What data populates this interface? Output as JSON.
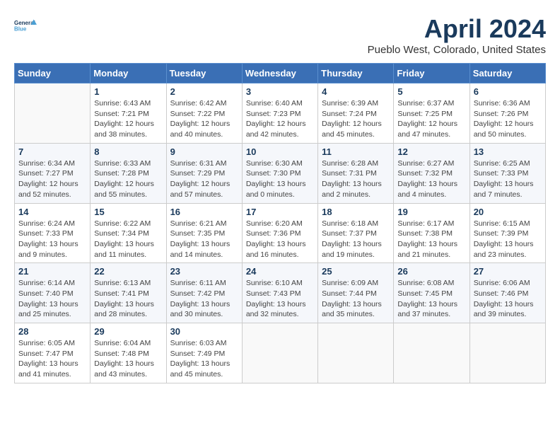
{
  "header": {
    "logo": {
      "line1": "General",
      "line2": "Blue"
    },
    "title": "April 2024",
    "location": "Pueblo West, Colorado, United States"
  },
  "weekdays": [
    "Sunday",
    "Monday",
    "Tuesday",
    "Wednesday",
    "Thursday",
    "Friday",
    "Saturday"
  ],
  "weeks": [
    [
      null,
      {
        "day": 1,
        "sunrise": "6:43 AM",
        "sunset": "7:21 PM",
        "daylight": "12 hours and 38 minutes."
      },
      {
        "day": 2,
        "sunrise": "6:42 AM",
        "sunset": "7:22 PM",
        "daylight": "12 hours and 40 minutes."
      },
      {
        "day": 3,
        "sunrise": "6:40 AM",
        "sunset": "7:23 PM",
        "daylight": "12 hours and 42 minutes."
      },
      {
        "day": 4,
        "sunrise": "6:39 AM",
        "sunset": "7:24 PM",
        "daylight": "12 hours and 45 minutes."
      },
      {
        "day": 5,
        "sunrise": "6:37 AM",
        "sunset": "7:25 PM",
        "daylight": "12 hours and 47 minutes."
      },
      {
        "day": 6,
        "sunrise": "6:36 AM",
        "sunset": "7:26 PM",
        "daylight": "12 hours and 50 minutes."
      }
    ],
    [
      {
        "day": 7,
        "sunrise": "6:34 AM",
        "sunset": "7:27 PM",
        "daylight": "12 hours and 52 minutes."
      },
      {
        "day": 8,
        "sunrise": "6:33 AM",
        "sunset": "7:28 PM",
        "daylight": "12 hours and 55 minutes."
      },
      {
        "day": 9,
        "sunrise": "6:31 AM",
        "sunset": "7:29 PM",
        "daylight": "12 hours and 57 minutes."
      },
      {
        "day": 10,
        "sunrise": "6:30 AM",
        "sunset": "7:30 PM",
        "daylight": "13 hours and 0 minutes."
      },
      {
        "day": 11,
        "sunrise": "6:28 AM",
        "sunset": "7:31 PM",
        "daylight": "13 hours and 2 minutes."
      },
      {
        "day": 12,
        "sunrise": "6:27 AM",
        "sunset": "7:32 PM",
        "daylight": "13 hours and 4 minutes."
      },
      {
        "day": 13,
        "sunrise": "6:25 AM",
        "sunset": "7:33 PM",
        "daylight": "13 hours and 7 minutes."
      }
    ],
    [
      {
        "day": 14,
        "sunrise": "6:24 AM",
        "sunset": "7:33 PM",
        "daylight": "13 hours and 9 minutes."
      },
      {
        "day": 15,
        "sunrise": "6:22 AM",
        "sunset": "7:34 PM",
        "daylight": "13 hours and 11 minutes."
      },
      {
        "day": 16,
        "sunrise": "6:21 AM",
        "sunset": "7:35 PM",
        "daylight": "13 hours and 14 minutes."
      },
      {
        "day": 17,
        "sunrise": "6:20 AM",
        "sunset": "7:36 PM",
        "daylight": "13 hours and 16 minutes."
      },
      {
        "day": 18,
        "sunrise": "6:18 AM",
        "sunset": "7:37 PM",
        "daylight": "13 hours and 19 minutes."
      },
      {
        "day": 19,
        "sunrise": "6:17 AM",
        "sunset": "7:38 PM",
        "daylight": "13 hours and 21 minutes."
      },
      {
        "day": 20,
        "sunrise": "6:15 AM",
        "sunset": "7:39 PM",
        "daylight": "13 hours and 23 minutes."
      }
    ],
    [
      {
        "day": 21,
        "sunrise": "6:14 AM",
        "sunset": "7:40 PM",
        "daylight": "13 hours and 25 minutes."
      },
      {
        "day": 22,
        "sunrise": "6:13 AM",
        "sunset": "7:41 PM",
        "daylight": "13 hours and 28 minutes."
      },
      {
        "day": 23,
        "sunrise": "6:11 AM",
        "sunset": "7:42 PM",
        "daylight": "13 hours and 30 minutes."
      },
      {
        "day": 24,
        "sunrise": "6:10 AM",
        "sunset": "7:43 PM",
        "daylight": "13 hours and 32 minutes."
      },
      {
        "day": 25,
        "sunrise": "6:09 AM",
        "sunset": "7:44 PM",
        "daylight": "13 hours and 35 minutes."
      },
      {
        "day": 26,
        "sunrise": "6:08 AM",
        "sunset": "7:45 PM",
        "daylight": "13 hours and 37 minutes."
      },
      {
        "day": 27,
        "sunrise": "6:06 AM",
        "sunset": "7:46 PM",
        "daylight": "13 hours and 39 minutes."
      }
    ],
    [
      {
        "day": 28,
        "sunrise": "6:05 AM",
        "sunset": "7:47 PM",
        "daylight": "13 hours and 41 minutes."
      },
      {
        "day": 29,
        "sunrise": "6:04 AM",
        "sunset": "7:48 PM",
        "daylight": "13 hours and 43 minutes."
      },
      {
        "day": 30,
        "sunrise": "6:03 AM",
        "sunset": "7:49 PM",
        "daylight": "13 hours and 45 minutes."
      },
      null,
      null,
      null,
      null
    ]
  ],
  "labels": {
    "sunrise": "Sunrise:",
    "sunset": "Sunset:",
    "daylight": "Daylight:"
  }
}
